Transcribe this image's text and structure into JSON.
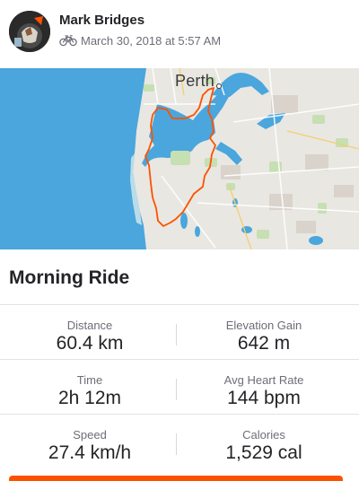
{
  "header": {
    "athlete_name": "Mark Bridges",
    "activity_icon": "bicycle-icon",
    "date_text": "March 30, 2018 at 5:57 AM"
  },
  "map": {
    "city_label": "Perth",
    "route_color": "#fc5200",
    "water_color": "#4aa6dc",
    "land_color": "#e9e7e2"
  },
  "activity": {
    "title": "Morning Ride"
  },
  "stats": [
    {
      "left_label": "Distance",
      "left_value": "60.4 km",
      "right_label": "Elevation Gain",
      "right_value": "642 m"
    },
    {
      "left_label": "Time",
      "left_value": "2h 12m",
      "right_label": "Avg Heart Rate",
      "right_value": "144 bpm"
    },
    {
      "left_label": "Speed",
      "left_value": "27.4 km/h",
      "right_label": "Calories",
      "right_value": "1,529 cal"
    }
  ],
  "colors": {
    "accent": "#fc5200",
    "text_primary": "#242428",
    "text_secondary": "#6d6d78"
  }
}
